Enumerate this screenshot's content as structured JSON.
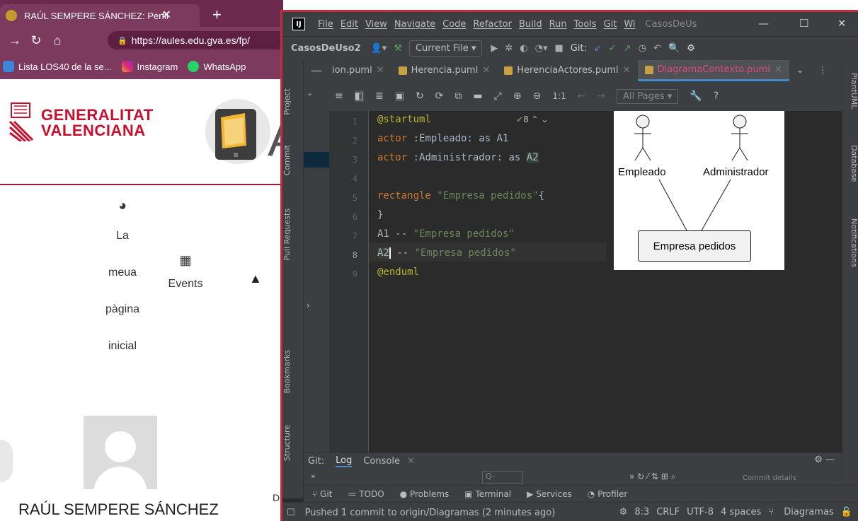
{
  "browser": {
    "tab_title": "RAÚL SEMPERE SÁNCHEZ: Perfil",
    "url": "https://aules.edu.gva.es/fp/",
    "bookmarks": [
      "Lista LOS40 de la se...",
      "Instagram",
      "WhatsApp"
    ],
    "logo_text": "GENERALITAT\nVALENCIANA",
    "menu": {
      "home_lines": [
        "La",
        "meua",
        "pàgina",
        "inicial"
      ],
      "events_label": "Events"
    },
    "user_name": "RAÚL SEMPERE SÁNCHEZ",
    "stray_letter": "D"
  },
  "ide": {
    "logo_text": "IJ",
    "menu": [
      "File",
      "Edit",
      "View",
      "Navigate",
      "Code",
      "Refactor",
      "Build",
      "Run",
      "Tools",
      "Git",
      "Wi"
    ],
    "project_title": "CasosDeUs",
    "toolbar": {
      "project": "CasosDeUso2",
      "run_config": "Current File",
      "git_label": "Git:"
    },
    "tabs": [
      {
        "label": "ion.puml",
        "active": false
      },
      {
        "label": "Herencia.puml",
        "active": false
      },
      {
        "label": "HerenciaActores.puml",
        "active": false
      },
      {
        "label": "DiagramaContexto.puml",
        "active": true
      }
    ],
    "left_tools": [
      "Project",
      "Commit",
      "Pull Requests",
      "Bookmarks",
      "Structure"
    ],
    "right_tools": [
      "PlantUML",
      "Database",
      "Notifications"
    ],
    "editor_toolbar": {
      "zoom": "1:1",
      "pages": "All Pages"
    },
    "inspection": "8",
    "line_numbers": [
      "1",
      "2",
      "3",
      "4",
      "5",
      "6",
      "7",
      "8",
      "9"
    ],
    "code": [
      "@startuml",
      "actor :Empleado: as A1",
      "actor :Administrador: as A2",
      "",
      "rectangle \"Empresa pedidos\"{",
      "}",
      "A1 -- \"Empresa pedidos\"",
      "A2 -- \"Empresa pedidos\"",
      "@enduml"
    ],
    "diagram": {
      "actors": [
        "Empleado",
        "Administrador"
      ],
      "rectangle": "Empresa pedidos"
    },
    "bottom_panel": {
      "git_label": "Git:",
      "tabs": [
        "Log",
        "Console"
      ],
      "search_placeholder": "Q-",
      "commit_details": "Commit details"
    },
    "tool_tabs": [
      "Git",
      "TODO",
      "Problems",
      "Terminal",
      "Services",
      "Profiler"
    ],
    "status": {
      "message": "Pushed 1 commit to origin/Diagramas (2 minutes ago)",
      "position": "8:3",
      "line_sep": "CRLF",
      "encoding": "UTF-8",
      "indent": "4 spaces",
      "branch": "Diagramas"
    }
  },
  "colors": {
    "browser_chrome": "#7d3a5f",
    "gva_red": "#c8102e",
    "ide_bg": "#2b2b2b",
    "ide_panel": "#3c3f41",
    "ide_border": "#c42b3c",
    "active_tab_text": "#e0487a"
  }
}
